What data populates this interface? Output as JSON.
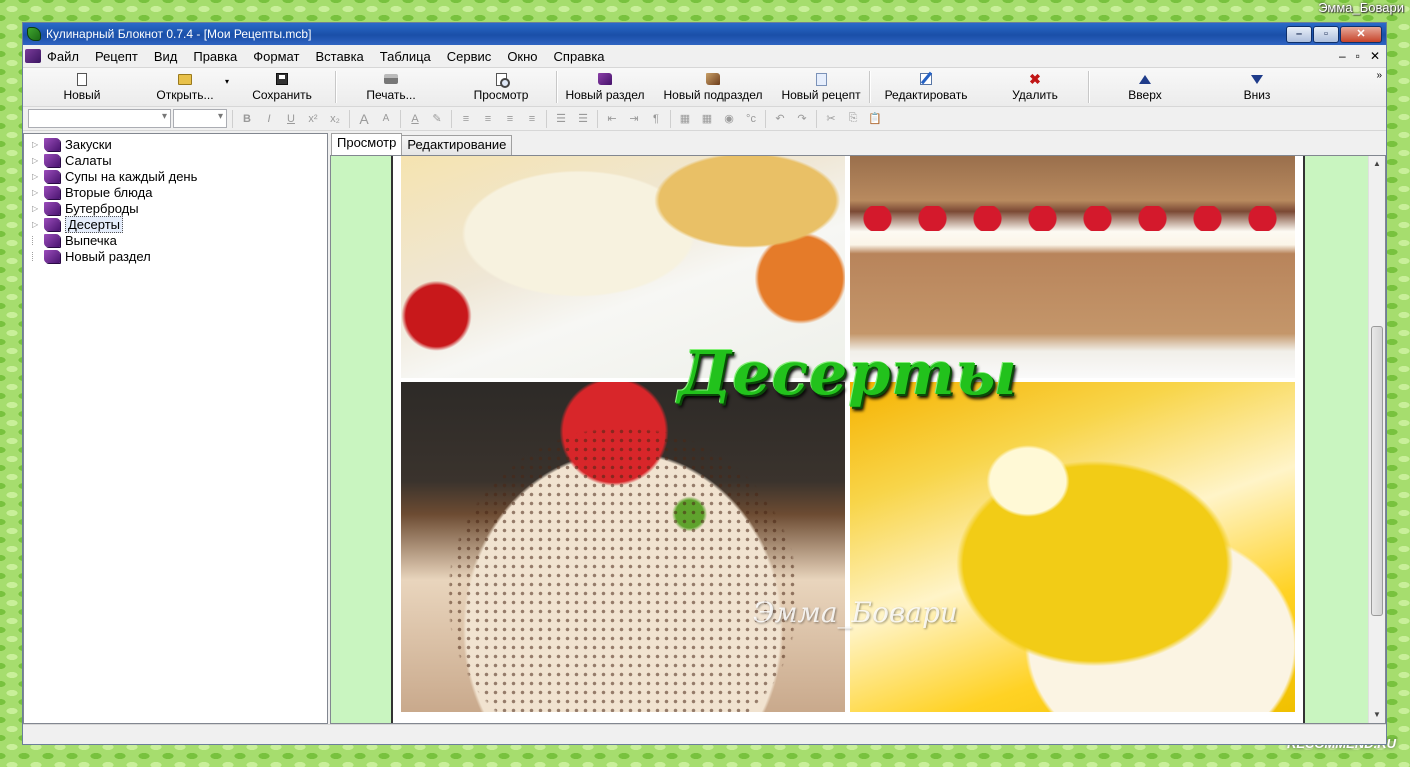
{
  "watermark_top": "Эмма_Бовари",
  "watermark_bottom": "RECOMMEND.RU",
  "window": {
    "title": "Кулинарный Блокнот 0.7.4 - [Мои Рецепты.mcb]",
    "minimize": "–",
    "maximize": "▫",
    "close": "✕"
  },
  "menu": {
    "items": [
      "Файл",
      "Рецепт",
      "Вид",
      "Правка",
      "Формат",
      "Вставка",
      "Таблица",
      "Сервис",
      "Окно",
      "Справка"
    ],
    "right": [
      "–",
      "▫",
      "✕"
    ]
  },
  "toolbar": {
    "new": "Новый",
    "open": "Открыть...",
    "save": "Сохранить",
    "print": "Печать...",
    "preview": "Просмотр",
    "new_section": "Новый раздел",
    "new_subsection": "Новый подраздел",
    "new_recipe": "Новый рецепт",
    "edit": "Редактировать",
    "delete": "Удалить",
    "up": "Вверх",
    "down": "Вниз",
    "more": "»"
  },
  "formatbar": {
    "font_value": "",
    "size_value": "",
    "buttons": [
      "B",
      "I",
      "U",
      "x²",
      "x₂",
      "A",
      "A",
      "A",
      "✎",
      "≡",
      "≡",
      "≡",
      "≡",
      "☰",
      "☰",
      "⇤",
      "⇥",
      "¶",
      "▦",
      "▦",
      "◉",
      "°c",
      "↶",
      "↷",
      "✂",
      "⎘",
      "📋"
    ]
  },
  "tree": {
    "items": [
      {
        "label": "Закуски",
        "expandable": true
      },
      {
        "label": "Салаты",
        "expandable": true
      },
      {
        "label": "Супы на каждый день",
        "expandable": true
      },
      {
        "label": "Вторые блюда",
        "expandable": true
      },
      {
        "label": "Бутерброды",
        "expandable": true
      },
      {
        "label": "Десерты",
        "expandable": true,
        "selected": true
      },
      {
        "label": "Выпечка",
        "expandable": false
      },
      {
        "label": "Новый раздел",
        "expandable": false
      }
    ]
  },
  "tabs": {
    "view": "Просмотр",
    "edit": "Редактирование"
  },
  "document": {
    "banner": "Десерты",
    "signature": "Эмма_Бовари"
  },
  "scrollbar": {
    "up": "▲",
    "down": "▼"
  },
  "colors": {
    "banner": "#22c21c",
    "viewer_bg": "#c9f5c0",
    "titlebar": "#1a4fa8"
  }
}
